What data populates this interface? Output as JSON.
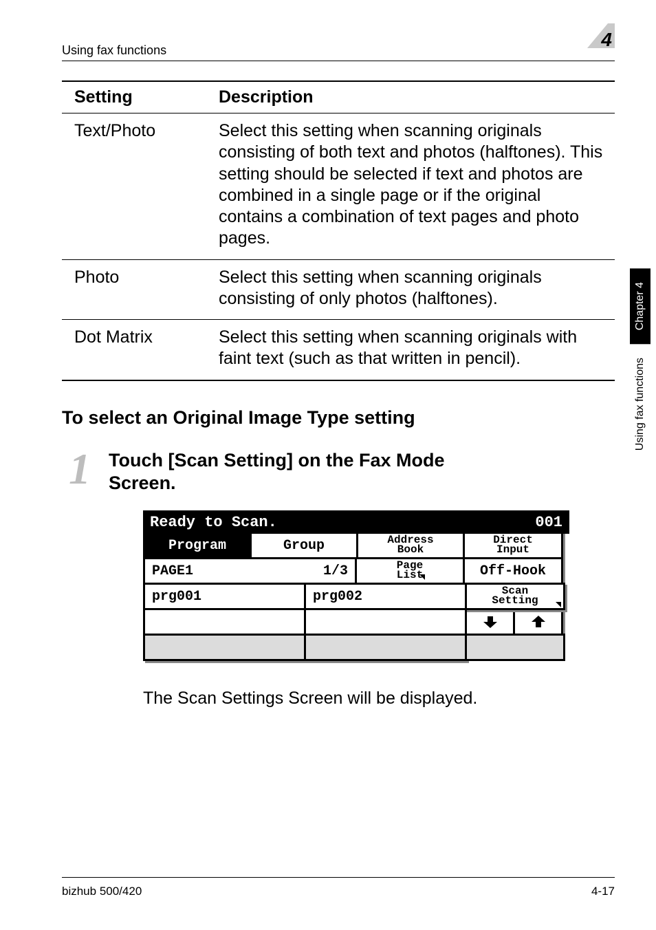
{
  "header": {
    "section": "Using fax functions",
    "chapter_badge": "4"
  },
  "table": {
    "head": {
      "c1": "Setting",
      "c2": "Description"
    },
    "rows": [
      {
        "c1": "Text/Photo",
        "c2": "Select this setting when scanning originals consisting of both text and photos (halftones). This setting should be selected if text and photos are combined in a single page or if the original contains a combination of text pages and photo pages."
      },
      {
        "c1": "Photo",
        "c2": "Select this setting when scanning originals consisting of only photos (halftones)."
      },
      {
        "c1": "Dot Matrix",
        "c2": "Select this setting when scanning originals with faint text (such as that written in pencil)."
      }
    ]
  },
  "subhead": "To select an Original Image Type setting",
  "step": {
    "num": "1",
    "text": "Touch [Scan Setting] on the Fax Mode Screen."
  },
  "lcd": {
    "status_left": "Ready to Scan.",
    "status_right": "001",
    "tabs": {
      "program": "Program",
      "group": "Group",
      "address_book_l1": "Address",
      "address_book_l2": "Book",
      "direct_l1": "Direct",
      "direct_l2": "Input"
    },
    "row3": {
      "page": "PAGE1",
      "frac": "1/3",
      "pagelist_l1": "Page",
      "pagelist_l2": "List",
      "offhook": "Off-Hook"
    },
    "row4": {
      "p1": "prg001",
      "p2": "prg002",
      "scan_l1": "Scan",
      "scan_l2": "Setting"
    }
  },
  "after_lcd": "The Scan Settings Screen will be displayed.",
  "sidetab": {
    "black": "Chapter 4",
    "white": "Using fax functions"
  },
  "footer": {
    "left": "bizhub 500/420",
    "right": "4-17"
  }
}
